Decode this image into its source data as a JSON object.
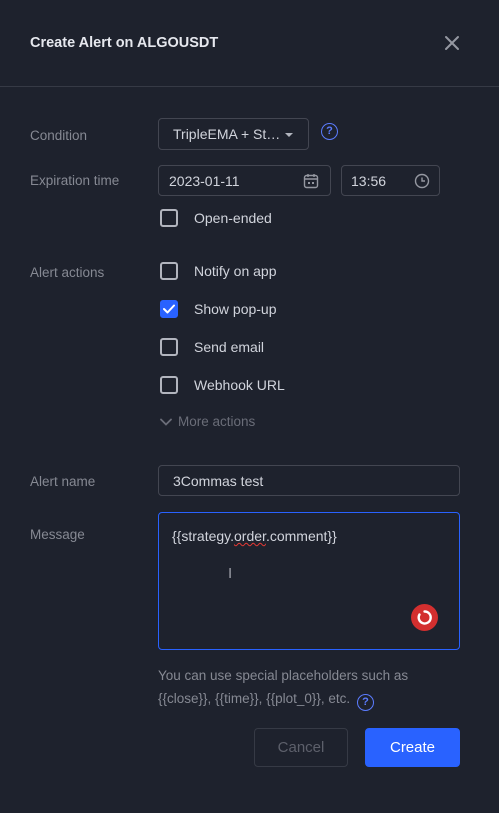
{
  "dialog": {
    "title": "Create Alert on ALGOUSDT"
  },
  "condition": {
    "label": "Condition",
    "value": "TripleEMA + St…"
  },
  "expiration": {
    "label": "Expiration time",
    "date": "2023-01-11",
    "time": "13:56",
    "open_ended_label": "Open-ended",
    "open_ended_checked": false
  },
  "actions": {
    "label": "Alert actions",
    "items": [
      {
        "label": "Notify on app",
        "checked": false
      },
      {
        "label": "Show pop-up",
        "checked": true
      },
      {
        "label": "Send email",
        "checked": false
      },
      {
        "label": "Webhook URL",
        "checked": false
      }
    ],
    "more_label": "More actions"
  },
  "alert_name": {
    "label": "Alert name",
    "value": "3Commas test"
  },
  "message": {
    "label": "Message",
    "value_prefix": "{{strategy.",
    "value_underlined": "order",
    "value_suffix": ".comment}}",
    "hint_line1": "You can use special placeholders such as",
    "hint_line2": "{{close}}, {{time}}, {{plot_0}}, etc."
  },
  "buttons": {
    "cancel": "Cancel",
    "create": "Create"
  },
  "colors": {
    "accent": "#2962ff",
    "background": "#1e222d",
    "text": "#d1d4dc",
    "muted": "#868993",
    "grammar_badge": "#d32f2f"
  },
  "icons": [
    "close-icon",
    "help-icon",
    "dropdown-caret-icon",
    "calendar-icon",
    "clock-icon",
    "chevron-down-icon",
    "checkmark-icon",
    "text-cursor-icon",
    "grammar-checker-icon"
  ]
}
